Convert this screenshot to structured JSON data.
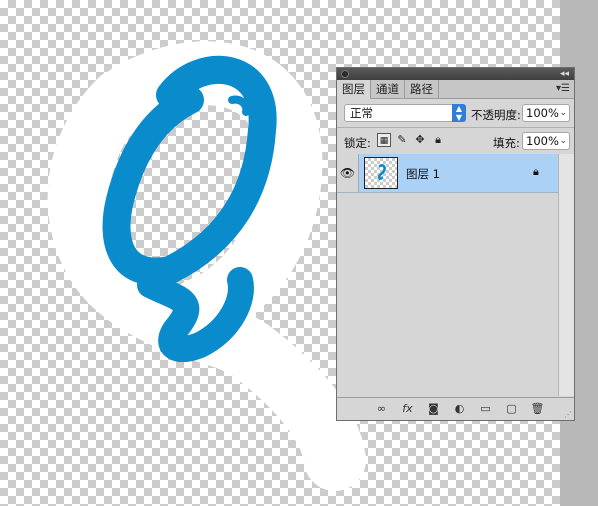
{
  "layers_panel": {
    "tabs": [
      {
        "label": "图层"
      },
      {
        "label": "通道"
      },
      {
        "label": "路径"
      }
    ],
    "menu_icon": "panel-menu-icon",
    "blend_mode": "正常",
    "opacity_label": "不透明度:",
    "opacity_value": "100%",
    "lock_label": "锁定:",
    "fill_label": "填充:",
    "fill_value": "100%",
    "layers": [
      {
        "name": "图层 1",
        "visible": true,
        "locked": true,
        "selected": true
      }
    ],
    "footer_icons": [
      "link-icon",
      "fx-icon",
      "mask-icon",
      "adjustment-icon",
      "folder-icon",
      "new-layer-icon",
      "trash-icon"
    ]
  },
  "colors": {
    "stroke_blue": "#0a8bcb",
    "selection_blue": "#abd1f7",
    "panel_gray": "#d6d6d6"
  }
}
